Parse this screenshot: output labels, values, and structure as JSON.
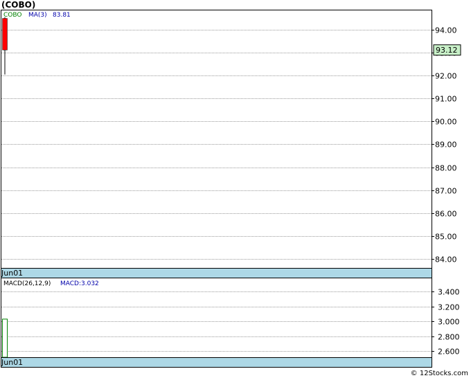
{
  "title": "(COBO)",
  "watermark": "© 12Stocks.com",
  "chart_data": [
    {
      "type": "candlestick",
      "panel": "price",
      "legend": {
        "symbol": "COBO",
        "ma_label": "MA(3)",
        "ma_value": "83.81"
      },
      "ylim": [
        83.6,
        94.85
      ],
      "yticks": [
        "94.00",
        "93.00",
        "92.00",
        "91.00",
        "90.00",
        "89.00",
        "88.00",
        "87.00",
        "86.00",
        "85.00",
        "84.00"
      ],
      "grid": true,
      "last_price_label": "93.12",
      "x_label": "Jun01",
      "candles": [
        {
          "open": 94.5,
          "close": 93.12,
          "high": 94.55,
          "low": 92.05
        }
      ],
      "colors": {
        "down": "#ff0000",
        "label_bg": "#c8f0c8",
        "axis_band": "#add8e6",
        "legend_symbol": "#008000",
        "legend_ma": "#0000aa"
      }
    },
    {
      "type": "bar",
      "panel": "macd",
      "legend": {
        "name": "MACD(26,12,9)",
        "value_label": "MACD:3.032"
      },
      "ylim": [
        2.52,
        3.58
      ],
      "yticks": [
        "3.400",
        "3.200",
        "3.000",
        "2.800",
        "2.600"
      ],
      "grid": true,
      "x_label": "Jun01",
      "values": [
        3.032
      ],
      "colors": {
        "bar": "#008000"
      }
    }
  ]
}
